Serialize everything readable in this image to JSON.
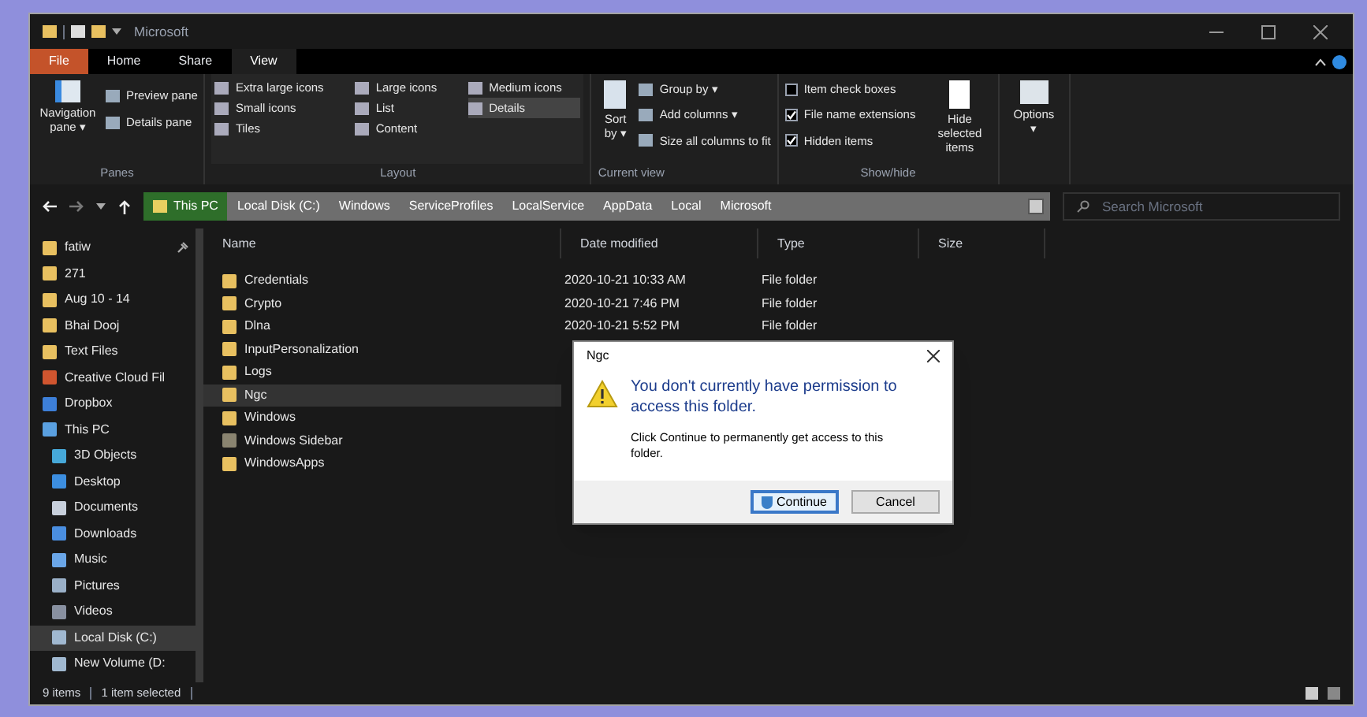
{
  "window": {
    "title": "Microsoft"
  },
  "tabs": [
    {
      "label": "File",
      "kind": "file",
      "selected": false
    },
    {
      "label": "Home",
      "kind": "tab",
      "selected": false
    },
    {
      "label": "Share",
      "kind": "tab",
      "selected": false
    },
    {
      "label": "View",
      "kind": "tab",
      "selected": true
    }
  ],
  "ribbon": {
    "panes": {
      "label": "Panes",
      "navigation": "Navigation pane ▾",
      "items": [
        "Preview pane",
        "Details pane"
      ]
    },
    "layout": {
      "label": "Layout",
      "items": [
        {
          "label": "Extra large icons",
          "selected": false
        },
        {
          "label": "Large icons",
          "selected": false
        },
        {
          "label": "Medium icons",
          "selected": false
        },
        {
          "label": "Small icons",
          "selected": false
        },
        {
          "label": "List",
          "selected": false
        },
        {
          "label": "Details",
          "selected": true
        },
        {
          "label": "Tiles",
          "selected": false
        },
        {
          "label": "Content",
          "selected": false
        }
      ]
    },
    "current_view": {
      "label": "Current view",
      "sort": "Sort by ▾",
      "items": [
        "Group by ▾",
        "Add columns ▾",
        "Size all columns to fit"
      ]
    },
    "show_hide": {
      "label": "Show/hide",
      "checkboxes": [
        {
          "label": "Item check boxes",
          "checked": false
        },
        {
          "label": "File name extensions",
          "checked": true
        },
        {
          "label": "Hidden items",
          "checked": true
        }
      ],
      "hide_selected": "Hide selected items"
    },
    "options": "Options ▾"
  },
  "address": {
    "segments": [
      {
        "label": "This PC",
        "selected": true
      },
      {
        "label": "Local Disk (C:)",
        "selected": false
      },
      {
        "label": "Windows",
        "selected": false
      },
      {
        "label": "ServiceProfiles",
        "selected": false
      },
      {
        "label": "LocalService",
        "selected": false
      },
      {
        "label": "AppData",
        "selected": false
      },
      {
        "label": "Local",
        "selected": false
      },
      {
        "label": "Microsoft",
        "selected": false
      }
    ],
    "search_placeholder": "Search Microsoft"
  },
  "sidebar": {
    "items": [
      {
        "label": "fatiw",
        "kind": "folder",
        "pinned": true,
        "selected": false
      },
      {
        "label": "271",
        "kind": "folder",
        "pinned": false,
        "selected": false
      },
      {
        "label": "Aug 10 - 14",
        "kind": "folder",
        "pinned": false,
        "selected": false
      },
      {
        "label": "Bhai Dooj",
        "kind": "folder",
        "pinned": false,
        "selected": false
      },
      {
        "label": "Text Files",
        "kind": "folder",
        "pinned": false,
        "selected": false
      },
      {
        "label": "Creative Cloud Fil",
        "kind": "cloud",
        "pinned": false,
        "selected": false
      },
      {
        "label": "Dropbox",
        "kind": "dropbox",
        "pinned": false,
        "selected": false
      },
      {
        "label": "This PC",
        "kind": "pc",
        "pinned": false,
        "selected": false,
        "children": [
          {
            "label": "3D Objects",
            "kind": "objects",
            "pinned": false,
            "selected": false
          },
          {
            "label": "Desktop",
            "kind": "desktop",
            "pinned": false,
            "selected": false
          },
          {
            "label": "Documents",
            "kind": "documents",
            "pinned": false,
            "selected": false
          },
          {
            "label": "Downloads",
            "kind": "downloads",
            "pinned": false,
            "selected": false
          },
          {
            "label": "Music",
            "kind": "music",
            "pinned": false,
            "selected": false
          },
          {
            "label": "Pictures",
            "kind": "pictures",
            "pinned": false,
            "selected": false
          },
          {
            "label": "Videos",
            "kind": "videos",
            "pinned": false,
            "selected": false
          },
          {
            "label": "Local Disk (C:)",
            "kind": "disk",
            "pinned": false,
            "selected": true
          },
          {
            "label": "New Volume (D:",
            "kind": "disk",
            "pinned": false,
            "selected": false
          }
        ]
      }
    ]
  },
  "table": {
    "columns": [
      "Name",
      "Date modified",
      "Type",
      "Size"
    ],
    "rows": [
      {
        "name": "Credentials",
        "date": "2020-10-21 10:33 AM",
        "type": "File folder",
        "kind": "folder",
        "selected": false
      },
      {
        "name": "Crypto",
        "date": "2020-10-21 7:46 PM",
        "type": "File folder",
        "kind": "folder",
        "selected": false
      },
      {
        "name": "Dlna",
        "date": "2020-10-21 5:52 PM",
        "type": "File folder",
        "kind": "folder",
        "selected": false
      },
      {
        "name": "InputPersonalization",
        "kind": "folder",
        "selected": false
      },
      {
        "name": "Logs",
        "kind": "folder",
        "selected": false
      },
      {
        "name": "Ngc",
        "kind": "folder",
        "selected": true
      },
      {
        "name": "Windows",
        "kind": "folder",
        "selected": false
      },
      {
        "name": "Windows Sidebar",
        "kind": "grey",
        "selected": false
      },
      {
        "name": "WindowsApps",
        "kind": "folder",
        "selected": false
      }
    ]
  },
  "dialog": {
    "title": "Ngc",
    "heading": "You don't currently have permission to access this folder.",
    "body": "Click Continue to permanently get access to this folder.",
    "buttons": [
      {
        "label": "Continue",
        "kind": "primary"
      },
      {
        "label": "Cancel",
        "kind": "plain"
      }
    ]
  },
  "status_bar": {
    "count": "9 items",
    "selection": "1 item selected"
  }
}
